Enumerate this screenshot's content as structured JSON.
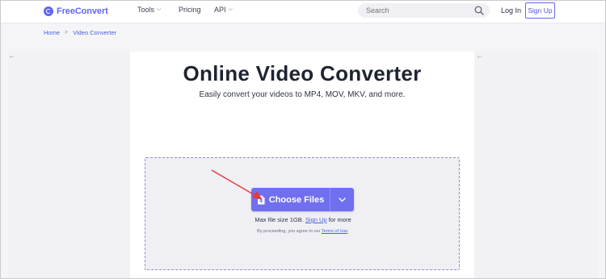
{
  "header": {
    "logo_text": "FreeConvert",
    "nav": [
      {
        "label": "Tools",
        "has_dropdown": true
      },
      {
        "label": "Pricing",
        "has_dropdown": false
      },
      {
        "label": "API",
        "has_dropdown": true
      }
    ],
    "search_placeholder": "Search",
    "login_label": "Log In",
    "signup_label": "Sign Up"
  },
  "breadcrumb": {
    "home": "Home",
    "current": "Video Converter"
  },
  "main": {
    "title": "Online Video Converter",
    "subtitle": "Easily convert your videos to MP4, MOV, MKV, and more."
  },
  "upload": {
    "choose_label": "Choose Files",
    "max_prefix": "Max file size 1GB.",
    "max_link": "Sign Up",
    "max_suffix": "for more",
    "terms_prefix": "By proceeding, you agree to our",
    "terms_link": "Terms of Use",
    "terms_suffix": "."
  },
  "colors": {
    "brand": "#6366f1",
    "button": "#6f6ff0",
    "annotation_arrow": "#e23b3b",
    "link": "#4a62d6"
  },
  "icons": [
    "logo-icon",
    "chevron-down-icon",
    "search-icon",
    "file-icon",
    "back-arrow-icon"
  ]
}
